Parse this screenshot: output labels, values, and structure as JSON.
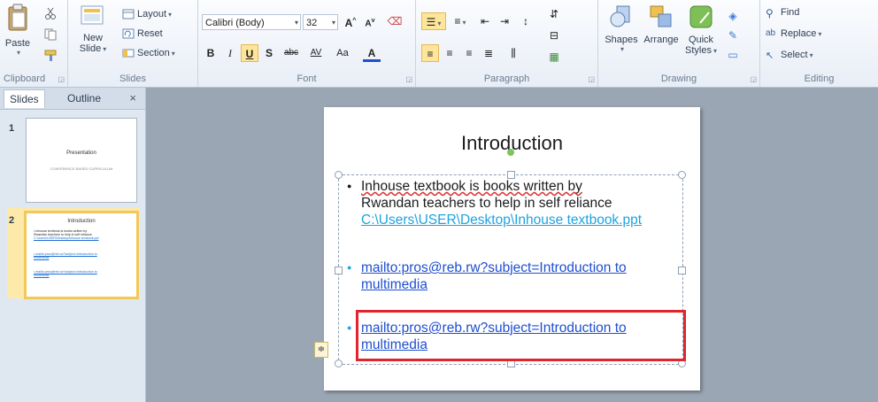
{
  "ribbon": {
    "clipboard": {
      "paste": "Paste",
      "label": "Clipboard"
    },
    "slides": {
      "new_slide_line1": "New",
      "new_slide_line2": "Slide",
      "layout": "Layout",
      "reset": "Reset",
      "section": "Section",
      "label": "Slides"
    },
    "font": {
      "font_name": "Calibri (Body)",
      "font_size": "32",
      "label": "Font",
      "bold": "B",
      "italic": "I",
      "underline": "U",
      "shadow": "S",
      "strike": "abc",
      "spacing": "AV",
      "case": "Aa",
      "color": "A"
    },
    "paragraph": {
      "label": "Paragraph"
    },
    "drawing": {
      "shapes": "Shapes",
      "arrange": "Arrange",
      "quick_styles_line1": "Quick",
      "quick_styles_line2": "Styles",
      "label": "Drawing"
    },
    "editing": {
      "find": "Find",
      "replace": "Replace",
      "select": "Select",
      "label": "Editing"
    }
  },
  "panel": {
    "tabs": [
      "Slides",
      "Outline"
    ],
    "close": "×",
    "thumbs": [
      {
        "num": "1",
        "title": "Presentation",
        "subtitle": "CONFERENCE BASED CURRICULUM"
      },
      {
        "num": "2",
        "title": "Introduction",
        "lines": [
          "• Inhouse textbook is books written by",
          "  Rwandan teachers to help in self reliance",
          "  C:\\Users\\USER\\Desktop\\Inhouse textbook.ppt",
          "• mailto:pros@reb.rw?subject=Introduction to",
          "  multimedia",
          "• mailto:pros@reb.rw?subject=Introduction to",
          "  multimedia"
        ]
      }
    ]
  },
  "slide": {
    "title": "Introduction",
    "bullet1_line1": "Inhouse textbook is books written by",
    "bullet1_line2": "Rwandan teachers to help in self reliance",
    "bullet1_path": "C:\\Users\\USER\\Desktop\\Inhouse textbook.ppt",
    "bullet2_line1": "mailto:pros@reb.rw?subject=Introduction to",
    "bullet2_line2": "multimedia",
    "bullet3_line1": "mailto:pros@reb.rw?subject=Introduction to",
    "bullet3_line2": "multimedia"
  },
  "colors": {
    "highlight_box": "#e2242c",
    "link": "#1f4fd1",
    "path_link": "#1ea3e0",
    "accent_selected": "#f3c75a"
  }
}
